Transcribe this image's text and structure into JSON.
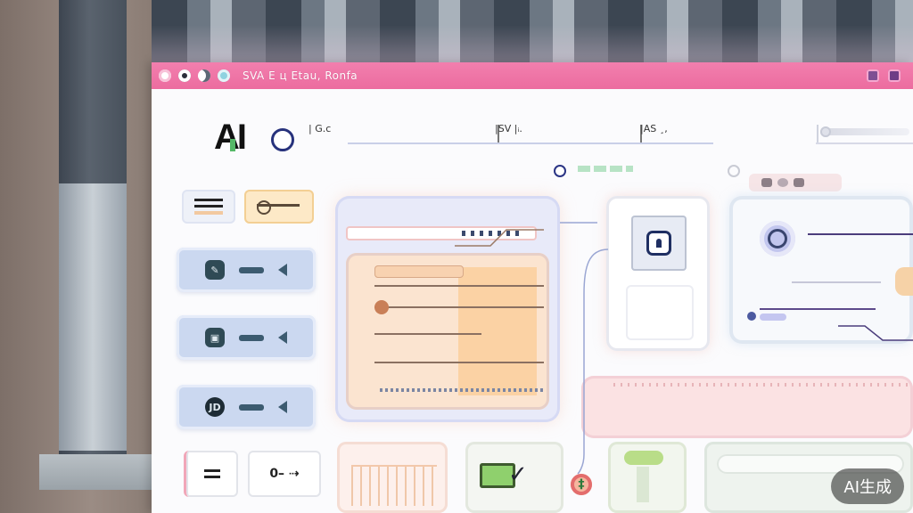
{
  "window": {
    "title": "SVA E  ц Etau, Ronfa",
    "logo_text": "AI",
    "traffic_lights": [
      "light-icon",
      "dark-icon",
      "half-icon",
      "teal-icon"
    ],
    "title_buttons": [
      "restore-icon",
      "expand-icon"
    ]
  },
  "header": {
    "crumbs": [
      "| G.c",
      "|SV |ᵢ.",
      "|AS ¸,"
    ]
  },
  "sidebar": {
    "items": [
      {
        "icon": "pen-icon",
        "glyph": "✎"
      },
      {
        "icon": "document-icon",
        "glyph": "▣"
      },
      {
        "icon": "jd-icon",
        "glyph": "JD"
      }
    ],
    "bottom_link_label": "0– ⇢"
  },
  "badge": {
    "label": "AI生成"
  },
  "colors": {
    "titlebar": "#ec6c9f",
    "sidebar_button": "#cbd8f0",
    "card_peach": "#fbe4d0",
    "accent_navy": "#1f2f62",
    "accent_green": "#8fd06d"
  }
}
